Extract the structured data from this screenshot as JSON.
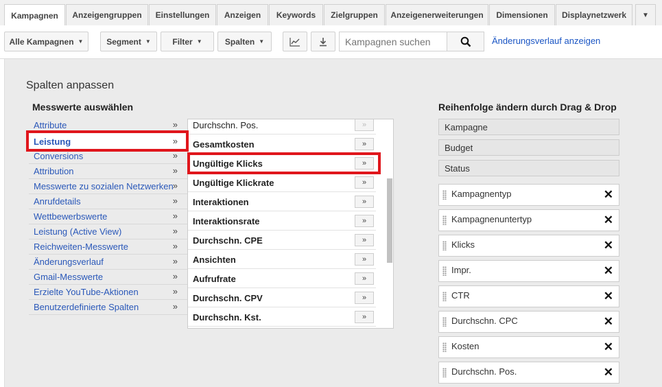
{
  "tabs": [
    "Kampagnen",
    "Anzeigengruppen",
    "Einstellungen",
    "Anzeigen",
    "Keywords",
    "Zielgruppen",
    "Anzeigenerweiterungen",
    "Dimensionen",
    "Displaynetzwerk"
  ],
  "tabs_more_glyph": "▼",
  "active_tab": "Kampagnen",
  "toolbar": {
    "all_campaigns": "Alle Kampagnen",
    "segment": "Segment",
    "filter": "Filter",
    "columns": "Spalten",
    "search_placeholder": "Kampagnen suchen",
    "history_link": "Änderungsverlauf anzeigen",
    "caret": "▼",
    "icons": {
      "chart": "line-chart-icon",
      "download": "download-icon",
      "search": "search-icon"
    }
  },
  "panel": {
    "title": "Spalten anpassen",
    "metrics_heading": "Messwerte auswählen",
    "order_heading": "Reihenfolge ändern durch Drag & Drop",
    "arrow_glyph": "»",
    "categories": [
      "Attribute",
      "Leistung",
      "Conversions",
      "Attribution",
      "Messwerte zu sozialen Netzwerken",
      "Anrufdetails",
      "Wettbewerbswerte",
      "Leistung (Active View)",
      "Reichweiten-Messwerte",
      "Änderungsverlauf",
      "Gmail-Messwerte",
      "Erzielte YouTube-Aktionen",
      "Benutzerdefinierte Spalten"
    ],
    "selected_category": "Leistung",
    "metrics": [
      "Durchschn. Pos.",
      "Gesamtkosten",
      "Ungültige Klicks",
      "Ungültige Klickrate",
      "Interaktionen",
      "Interaktionsrate",
      "Durchschn. CPE",
      "Ansichten",
      "Aufrufrate",
      "Durchschn. CPV",
      "Durchschn. Kst."
    ],
    "highlighted_metric": "Ungültige Klicks",
    "fixed_columns": [
      "Kampagne",
      "Budget",
      "Status"
    ],
    "draggable_columns": [
      "Kampagnentyp",
      "Kampagnenuntertyp",
      "Klicks",
      "Impr.",
      "CTR",
      "Durchschn. CPC",
      "Kosten",
      "Durchschn. Pos."
    ],
    "remove_glyph": "✕",
    "highlight_color": "#e0161c",
    "link_color": "#2a58b9"
  }
}
